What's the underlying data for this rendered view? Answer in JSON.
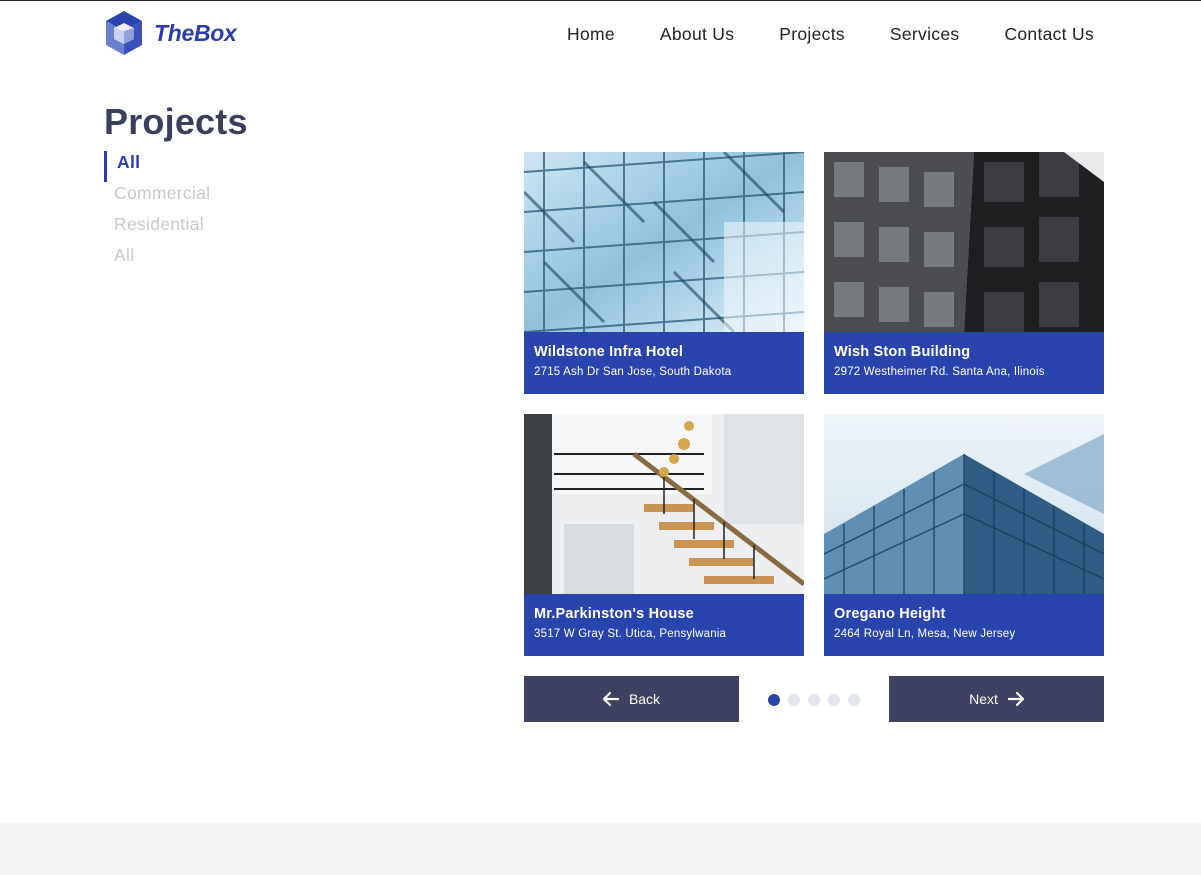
{
  "brand": {
    "name": "TheBox",
    "color": "#2a3fa9"
  },
  "nav": {
    "items": [
      {
        "label": "Home"
      },
      {
        "label": "About Us"
      },
      {
        "label": "Projects"
      },
      {
        "label": "Services"
      },
      {
        "label": "Contact Us"
      }
    ]
  },
  "page": {
    "title": "Projects"
  },
  "filters": [
    {
      "label": "All",
      "active": true
    },
    {
      "label": "Commercial",
      "active": false
    },
    {
      "label": "Residential",
      "active": false
    },
    {
      "label": "All",
      "active": false
    }
  ],
  "projects": [
    {
      "title": "Wildstone Infra Hotel",
      "address": "2715 Ash Dr San Jose, South Dakota",
      "image": "glass-facade-image"
    },
    {
      "title": "Wish Ston Building",
      "address": "2972 Westheimer Rd. Santa Ana, Ilinois",
      "image": "dark-tower-image"
    },
    {
      "title": "Mr.Parkinston's House",
      "address": "3517 W Gray St. Utica, Pensylwania",
      "image": "staircase-interior-image"
    },
    {
      "title": "Oregano Height",
      "address": "2464 Royal Ln, Mesa, New Jersey",
      "image": "glass-skyscraper-image"
    }
  ],
  "pagination": {
    "back_label": "Back",
    "next_label": "Next",
    "pages": 5,
    "current": 1
  },
  "colors": {
    "accent": "#2a44ad",
    "button": "#3e4260",
    "title": "#3a3f5c",
    "footer": "#f4f6f6"
  }
}
